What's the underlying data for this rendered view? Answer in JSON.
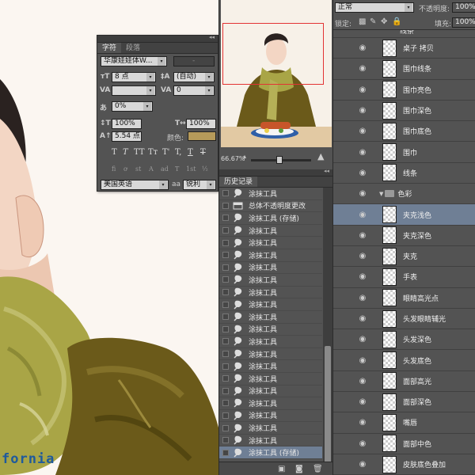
{
  "canvas": {
    "visible_text": "fornia",
    "colors": {
      "background": "#fbf6f1",
      "jacket": "#6b5a1a",
      "scarf": "#a9a546",
      "skin": "#f3d6c4",
      "text": "#1f5a9c"
    }
  },
  "character_panel": {
    "tabs": [
      "字符",
      "段落"
    ],
    "font_family": "华康娃娃体W...",
    "font_style": "-",
    "font_size": "8 点",
    "leading": "(自动)",
    "tracking": "0",
    "kerning": "",
    "tsume": "0%",
    "vertical_scale": "100%",
    "horizontal_scale": "100%",
    "baseline_shift": "5.54 点",
    "color_label": "颜色:",
    "color": "#b59a5a",
    "type_buttons": [
      "T",
      "T",
      "TT",
      "Tт",
      "T'",
      "T,",
      "T",
      "T"
    ],
    "ot_buttons": [
      "fi",
      "ơ",
      "st",
      "A",
      "ad",
      "T",
      "1st",
      "½"
    ],
    "language": "美国英语",
    "aa_icon": "aa",
    "antialias": "锐利"
  },
  "navigator": {
    "zoom": "66.67%",
    "highlight_color": "#e33333"
  },
  "history": {
    "tab": "历史记录",
    "items": [
      {
        "label": "涂抹工具",
        "icon": "smudge-icon"
      },
      {
        "label": "总体不透明度更改",
        "icon": "opacity-icon"
      },
      {
        "label": "涂抹工具 (存储)",
        "icon": "smudge-icon"
      },
      {
        "label": "涂抹工具",
        "icon": "smudge-icon"
      },
      {
        "label": "涂抹工具",
        "icon": "smudge-icon"
      },
      {
        "label": "涂抹工具",
        "icon": "smudge-icon"
      },
      {
        "label": "涂抹工具",
        "icon": "smudge-icon"
      },
      {
        "label": "涂抹工具",
        "icon": "smudge-icon"
      },
      {
        "label": "涂抹工具",
        "icon": "smudge-icon"
      },
      {
        "label": "涂抹工具",
        "icon": "smudge-icon"
      },
      {
        "label": "涂抹工具",
        "icon": "smudge-icon"
      },
      {
        "label": "涂抹工具",
        "icon": "smudge-icon"
      },
      {
        "label": "涂抹工具",
        "icon": "smudge-icon"
      },
      {
        "label": "涂抹工具",
        "icon": "smudge-icon"
      },
      {
        "label": "涂抹工具",
        "icon": "smudge-icon"
      },
      {
        "label": "涂抹工具",
        "icon": "smudge-icon"
      },
      {
        "label": "涂抹工具",
        "icon": "smudge-icon"
      },
      {
        "label": "涂抹工具",
        "icon": "smudge-icon"
      },
      {
        "label": "涂抹工具",
        "icon": "smudge-icon"
      },
      {
        "label": "涂抹工具",
        "icon": "smudge-icon"
      },
      {
        "label": "涂抹工具",
        "icon": "smudge-icon"
      },
      {
        "label": "涂抹工具 (存储)",
        "icon": "smudge-icon"
      }
    ],
    "selected_index": 21,
    "footer_icons": [
      "new-document-from-state-icon",
      "snapshot-icon",
      "trash-icon"
    ]
  },
  "layers": {
    "blend_mode": "正常",
    "opacity_label": "不透明度:",
    "opacity": "100%",
    "lock_label": "锁定:",
    "fill_label": "填充:",
    "fill": "100%",
    "top_partial": "线条",
    "items": [
      {
        "name": "桌子 拷贝",
        "type": "layer"
      },
      {
        "name": "围巾线条",
        "type": "layer"
      },
      {
        "name": "围巾亮色",
        "type": "layer"
      },
      {
        "name": "围巾深色",
        "type": "layer"
      },
      {
        "name": "围巾底色",
        "type": "layer"
      },
      {
        "name": "围巾",
        "type": "layer"
      },
      {
        "name": "线条",
        "type": "layer"
      },
      {
        "name": "色彩",
        "type": "group"
      },
      {
        "name": "夹克浅色",
        "type": "layer",
        "selected": true
      },
      {
        "name": "夹克深色",
        "type": "layer"
      },
      {
        "name": "夹克",
        "type": "layer"
      },
      {
        "name": "手表",
        "type": "layer"
      },
      {
        "name": "眼睛高光点",
        "type": "layer"
      },
      {
        "name": "头发眼睛辅光",
        "type": "layer"
      },
      {
        "name": "头发深色",
        "type": "layer"
      },
      {
        "name": "头发底色",
        "type": "layer"
      },
      {
        "name": "面部高光",
        "type": "layer"
      },
      {
        "name": "面部深色",
        "type": "layer"
      },
      {
        "name": "嘴唇",
        "type": "layer"
      },
      {
        "name": "面部中色",
        "type": "layer"
      },
      {
        "name": "皮肤底色叠加",
        "type": "layer"
      }
    ]
  }
}
